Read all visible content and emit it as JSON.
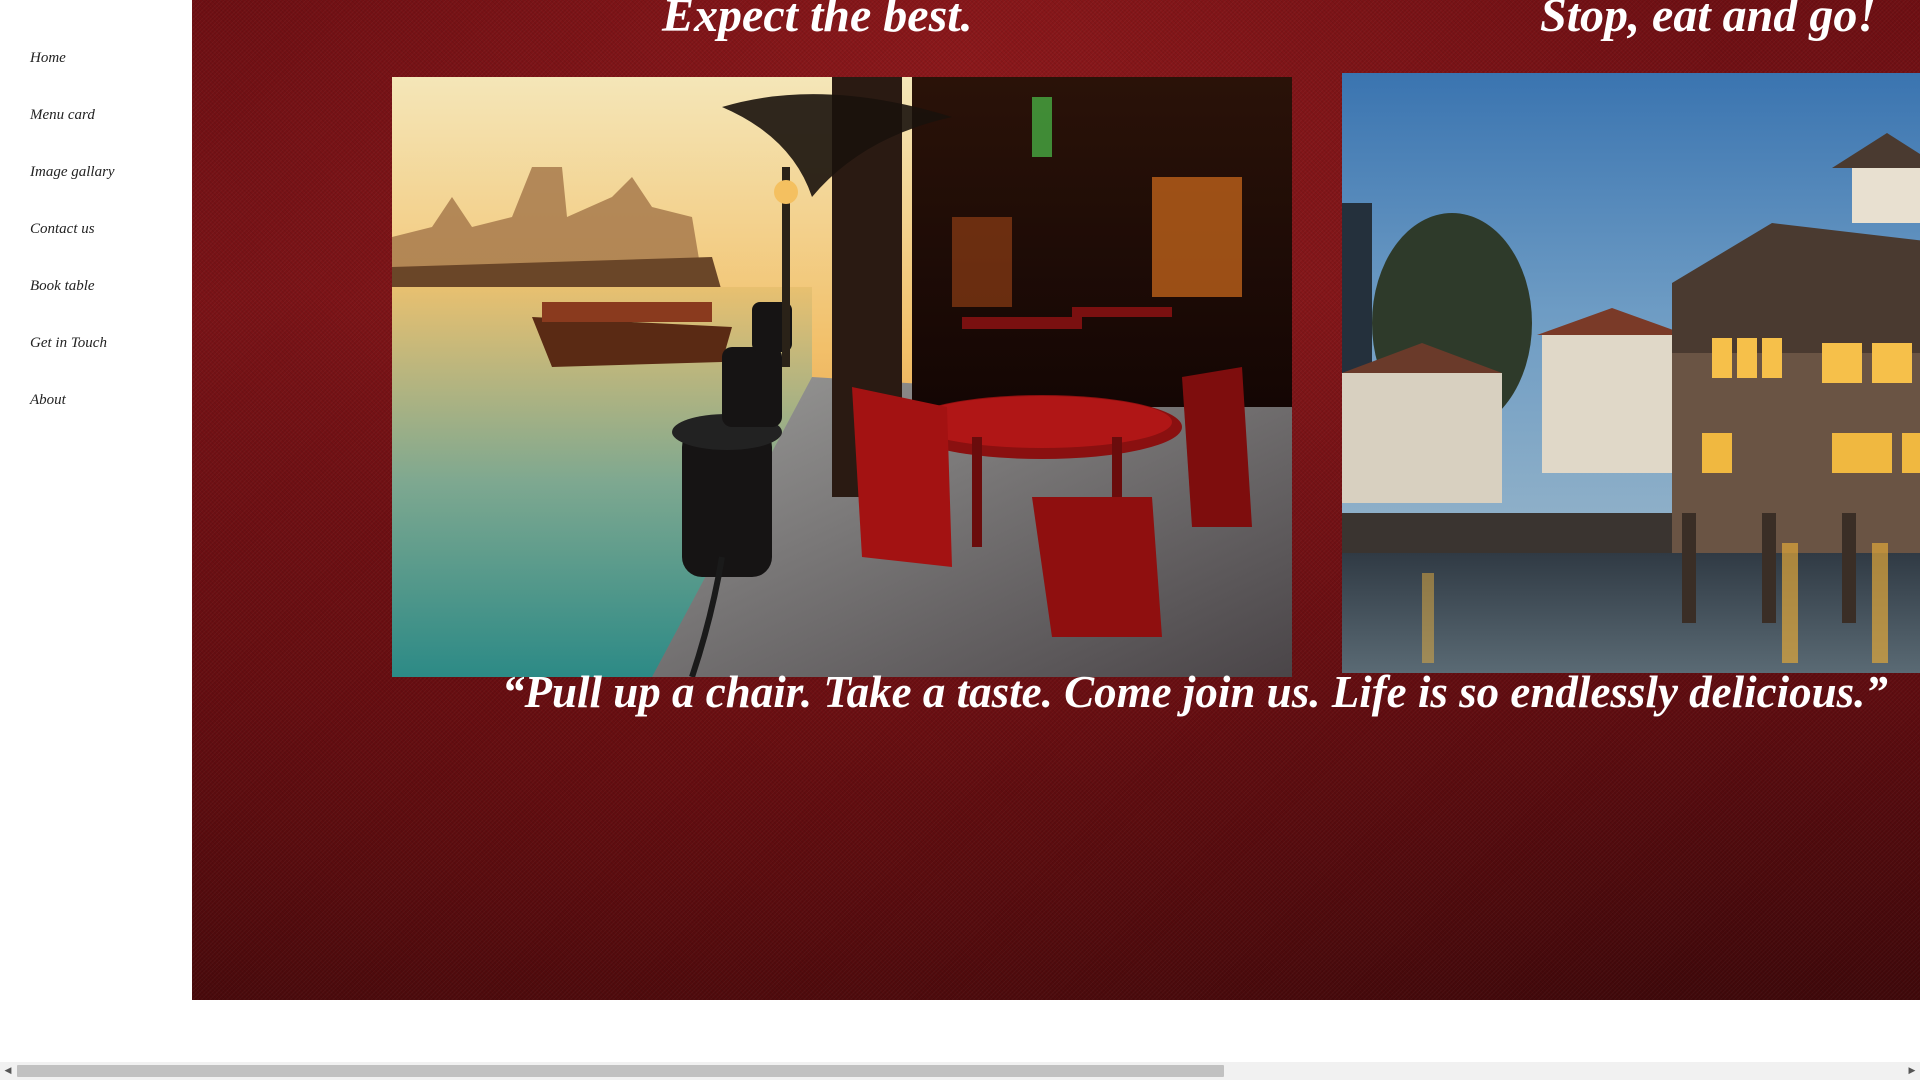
{
  "nav": {
    "items": [
      {
        "label": "Home",
        "id": "home"
      },
      {
        "label": "Menu card",
        "id": "menu-card"
      },
      {
        "label": "Image gallary",
        "id": "image-gallary"
      },
      {
        "label": "Contact us",
        "id": "contact-us"
      },
      {
        "label": "Book table",
        "id": "book-table"
      },
      {
        "label": "Get in Touch",
        "id": "get-in-touch"
      },
      {
        "label": "About",
        "id": "about"
      }
    ]
  },
  "hero": {
    "headline_left": "Expect the best.",
    "headline_right": "Stop, eat and go!",
    "quote": "“Pull up a chair. Take a taste. Come join us. Life is so endlessly delicious.”"
  },
  "colors": {
    "hero_red": "#6e0f13",
    "text_white": "#ffffff",
    "nav_text": "#222222"
  },
  "scrollbar": {
    "left_arrow_icon": "triangle-left-icon",
    "right_arrow_icon": "triangle-right-icon",
    "position_fraction": 0
  }
}
